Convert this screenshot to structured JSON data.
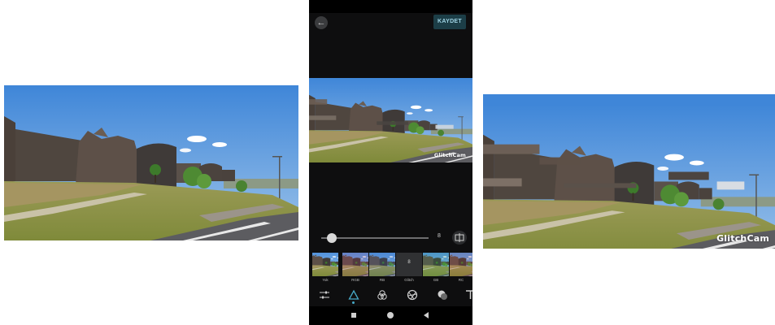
{
  "app": {
    "save_label": "KAYDET",
    "watermark": "GlitchCam",
    "slider_value": "8",
    "filters": [
      {
        "label": "Yok",
        "selected": false
      },
      {
        "label": "RGB",
        "selected": false
      },
      {
        "label": "RB",
        "selected": false
      },
      {
        "label": "Glitch",
        "selected": true,
        "value": "8"
      },
      {
        "label": "GB",
        "selected": false
      },
      {
        "label": "RC",
        "selected": false
      }
    ],
    "tools": [
      "adjust-icon",
      "glitch-tool-icon",
      "color-circles-icon",
      "aperture-icon",
      "overlay-icon",
      "text-icon"
    ],
    "active_tool": "glitch-tool-icon",
    "accent_color": "#47a9c7",
    "save_button_color": "#1c3e47"
  },
  "slider": {
    "level_fraction": 0.06
  }
}
